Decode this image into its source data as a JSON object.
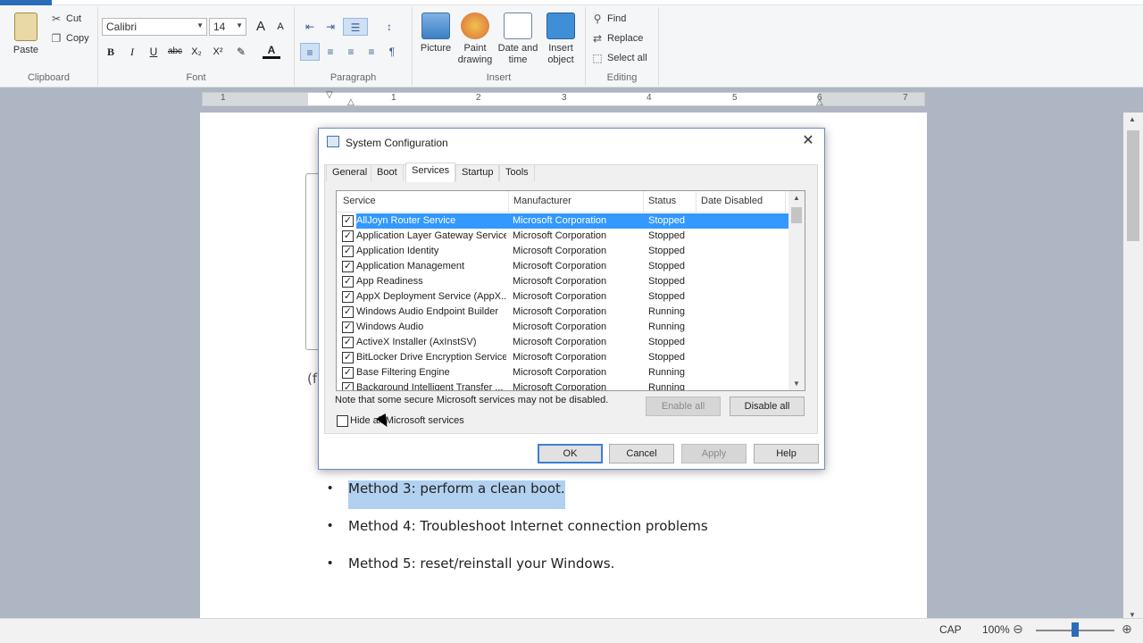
{
  "ribbon": {
    "clipboard": {
      "label": "Clipboard",
      "paste": "Paste",
      "cut": "Cut",
      "copy": "Copy"
    },
    "font": {
      "label": "Font",
      "family": "Calibri",
      "size": "14",
      "bold": "B",
      "italic": "I",
      "underline": "U",
      "strike": "abc",
      "subscript": "X₂",
      "superscript": "X²"
    },
    "paragraph": {
      "label": "Paragraph"
    },
    "insert": {
      "label": "Insert",
      "picture": "Picture",
      "paint_drawing": "Paint drawing",
      "date_time": "Date and time",
      "insert_object": "Insert object"
    },
    "editing": {
      "label": "Editing",
      "find": "Find",
      "replace": "Replace",
      "select_all": "Select all"
    }
  },
  "ruler": {
    "ticks": [
      "1",
      "1",
      "2",
      "3",
      "4",
      "5",
      "6",
      "7"
    ]
  },
  "document": {
    "partial_text": "(f",
    "bullets": [
      "Method 3: perform a clean boot.",
      "Method 4: Troubleshoot Internet connection problems",
      "Method 5: reset/reinstall your Windows."
    ]
  },
  "dialog": {
    "title": "System Configuration",
    "close": "✕",
    "tabs": [
      "General",
      "Boot",
      "Services",
      "Startup",
      "Tools"
    ],
    "active_tab": "Services",
    "columns": [
      "Service",
      "Manufacturer",
      "Status",
      "Date Disabled"
    ],
    "rows": [
      {
        "service": "AllJoyn Router Service",
        "manufacturer": "Microsoft Corporation",
        "status": "Stopped",
        "checked": true,
        "selected": true
      },
      {
        "service": "Application Layer Gateway Service",
        "manufacturer": "Microsoft Corporation",
        "status": "Stopped",
        "checked": true
      },
      {
        "service": "Application Identity",
        "manufacturer": "Microsoft Corporation",
        "status": "Stopped",
        "checked": true
      },
      {
        "service": "Application Management",
        "manufacturer": "Microsoft Corporation",
        "status": "Stopped",
        "checked": true
      },
      {
        "service": "App Readiness",
        "manufacturer": "Microsoft Corporation",
        "status": "Stopped",
        "checked": true
      },
      {
        "service": "AppX Deployment Service (AppX...",
        "manufacturer": "Microsoft Corporation",
        "status": "Stopped",
        "checked": true
      },
      {
        "service": "Windows Audio Endpoint Builder",
        "manufacturer": "Microsoft Corporation",
        "status": "Running",
        "checked": true
      },
      {
        "service": "Windows Audio",
        "manufacturer": "Microsoft Corporation",
        "status": "Running",
        "checked": true
      },
      {
        "service": "ActiveX Installer (AxInstSV)",
        "manufacturer": "Microsoft Corporation",
        "status": "Stopped",
        "checked": true
      },
      {
        "service": "BitLocker Drive Encryption Service",
        "manufacturer": "Microsoft Corporation",
        "status": "Stopped",
        "checked": true
      },
      {
        "service": "Base Filtering Engine",
        "manufacturer": "Microsoft Corporation",
        "status": "Running",
        "checked": true
      },
      {
        "service": "Background Intelligent Transfer ...",
        "manufacturer": "Microsoft Corporation",
        "status": "Running",
        "checked": true
      }
    ],
    "note": "Note that some secure Microsoft services may not be disabled.",
    "hide_ms_label": "Hide all Microsoft services",
    "buttons": {
      "enable_all": "Enable all",
      "disable_all": "Disable all",
      "ok": "OK",
      "cancel": "Cancel",
      "apply": "Apply",
      "help": "Help"
    }
  },
  "statusbar": {
    "caps": "CAP",
    "zoom": "100%",
    "zoom_out": "⊖",
    "zoom_in": "⊕",
    "zoom_level": 0.5
  },
  "colors": {
    "accent": "#2b6cb8",
    "selection": "#3399ff",
    "doc_selection": "#b2d1f1"
  }
}
